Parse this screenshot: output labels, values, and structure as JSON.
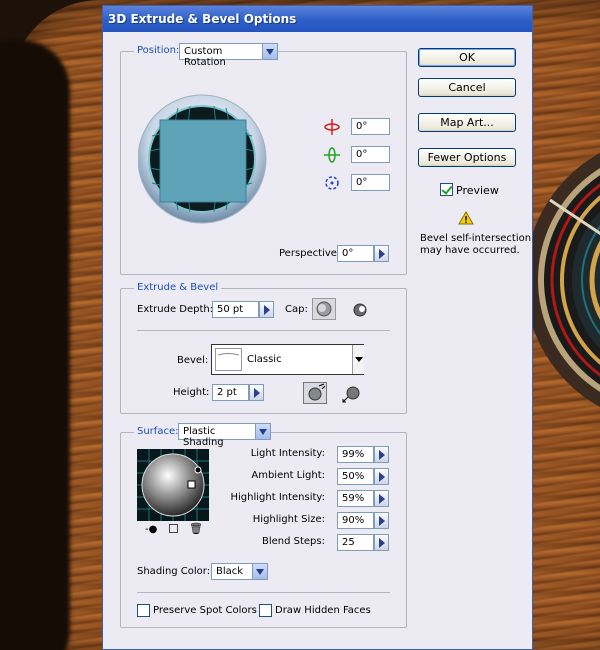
{
  "dialog": {
    "title": "3D Extrude & Bevel Options"
  },
  "position": {
    "legend": "Position:",
    "preset": "Custom Rotation",
    "rotate_x": "0°",
    "rotate_y": "0°",
    "rotate_z": "0°",
    "perspective_label": "Perspective:",
    "perspective_value": "0°"
  },
  "extrude": {
    "legend": "Extrude & Bevel",
    "depth_label": "Extrude Depth:",
    "depth_value": "50 pt",
    "cap_label": "Cap:",
    "bevel_label": "Bevel:",
    "bevel_value": "Classic",
    "height_label": "Height:",
    "height_value": "2 pt"
  },
  "surface": {
    "legend": "Surface:",
    "shading": "Plastic Shading",
    "light_intensity_label": "Light Intensity:",
    "light_intensity_value": "99%",
    "ambient_light_label": "Ambient Light:",
    "ambient_light_value": "50%",
    "highlight_intensity_label": "Highlight Intensity:",
    "highlight_intensity_value": "59%",
    "highlight_size_label": "Highlight Size:",
    "highlight_size_value": "90%",
    "blend_steps_label": "Blend Steps:",
    "blend_steps_value": "25",
    "shading_color_label": "Shading Color:",
    "shading_color_value": "Black",
    "preserve_spot_label": "Preserve Spot Colors",
    "draw_hidden_label": "Draw Hidden Faces"
  },
  "buttons": {
    "ok": "OK",
    "cancel": "Cancel",
    "map_art": "Map Art...",
    "fewer_options": "Fewer Options",
    "preview": "Preview"
  },
  "warning": {
    "text_line1": "Bevel self-intersection",
    "text_line2": "may have occurred."
  },
  "colors": {
    "title_bar": "#2d5fc8",
    "accent": "#1c4fb5",
    "cube_face": "#5ea3b8"
  }
}
